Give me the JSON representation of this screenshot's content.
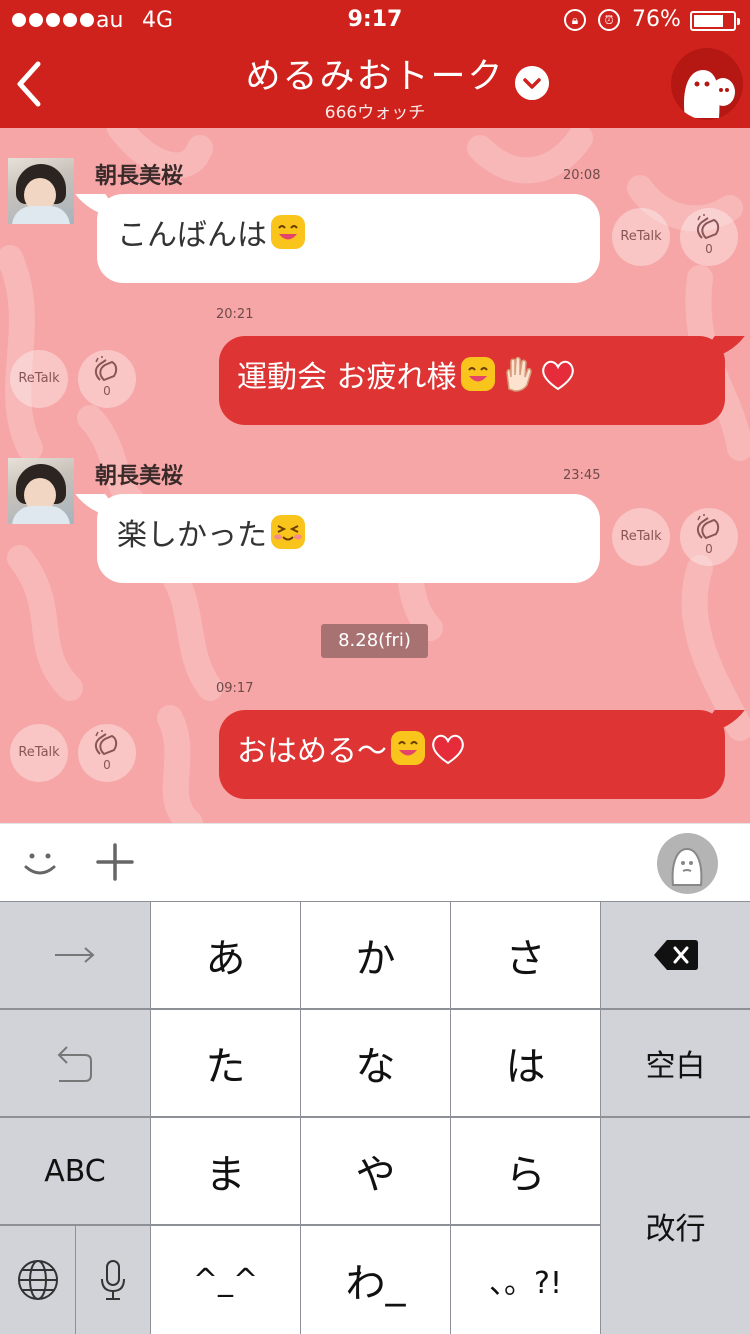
{
  "status_bar": {
    "carrier": "au",
    "network": "4G",
    "time": "9:17",
    "battery_percent": "76%",
    "battery_level": 0.76
  },
  "header": {
    "title": "めるみおトーク",
    "subtitle": "666ウォッチ",
    "back_icon": "chevron-left-icon",
    "dropdown_icon": "chevron-down-icon",
    "profile_icon": "ghost-avatar-icon"
  },
  "messages": [
    {
      "direction": "in",
      "sender": "朝長美桜",
      "time": "20:08",
      "text": "こんばんは",
      "emojis": [
        "smile"
      ],
      "retalk_label": "ReTalk",
      "clap_count": "0"
    },
    {
      "direction": "out",
      "time": "20:21",
      "text": "運動会 お疲れ様",
      "emojis": [
        "smile",
        "hand",
        "heart"
      ],
      "retalk_label": "ReTalk",
      "clap_count": "0"
    },
    {
      "direction": "in",
      "sender": "朝長美桜",
      "time": "23:45",
      "text": "楽しかった",
      "emojis": [
        "blush"
      ],
      "retalk_label": "ReTalk",
      "clap_count": "0"
    },
    {
      "direction": "out",
      "time": "09:17",
      "text": "おはめる〜",
      "emojis": [
        "smile",
        "heart"
      ],
      "retalk_label": "ReTalk",
      "clap_count": "0"
    }
  ],
  "date_divider": "8.28(fri)",
  "input_bar": {
    "icons": [
      "smiley-icon",
      "plus-icon",
      "stamp-icon"
    ]
  },
  "keyboard": {
    "row1": [
      "あ",
      "か",
      "さ"
    ],
    "row2": [
      "た",
      "な",
      "は"
    ],
    "row3": [
      "ま",
      "や",
      "ら"
    ],
    "row4": [
      "^_^",
      "わ_",
      "、。?!"
    ],
    "space_label": "空白",
    "abc_label": "ABC",
    "return_label": "改行",
    "side_icons": [
      "arrow-right-icon",
      "undo-icon",
      "globe-icon",
      "microphone-icon",
      "delete-icon"
    ]
  },
  "colors": {
    "accent": "#d0221c",
    "chat_background": "#f6a6a6",
    "outgoing_bubble": "#de3434",
    "date_chip": "#a97272"
  }
}
